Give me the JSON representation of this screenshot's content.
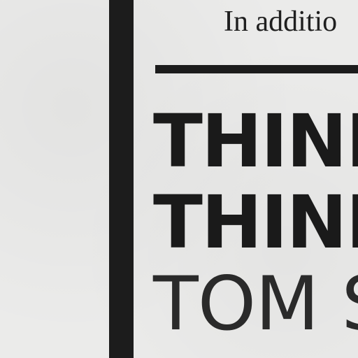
{
  "page": {
    "intro_text": "In additio",
    "heading_lines": [
      "THINKI",
      "THINKI",
      "TOM S"
    ]
  },
  "colors": {
    "paper": "#ebebea",
    "ink": "#1c1c1c"
  }
}
